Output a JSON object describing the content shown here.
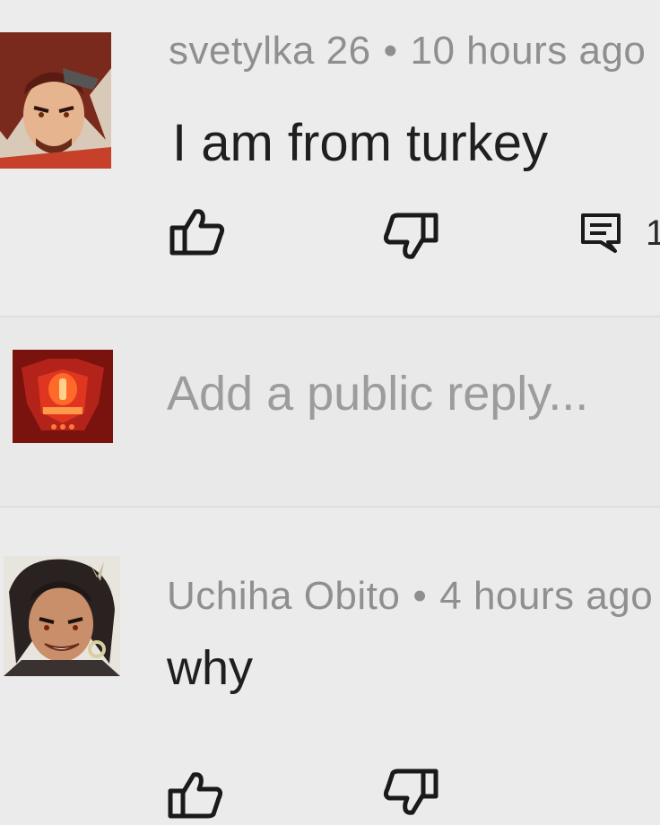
{
  "comments": [
    {
      "author": "svetylka 26",
      "separator": "•",
      "time": "10 hours ago",
      "text": "I am from turkey",
      "reply_count": "1",
      "avatar": "anime-warrior-avatar"
    },
    {
      "author": "Uchiha Obito",
      "separator": "•",
      "time": "4 hours ago",
      "text": "why",
      "avatar": "anime-woman-avatar"
    }
  ],
  "reply_box": {
    "placeholder": "Add a public reply...",
    "avatar": "red-robot-avatar"
  },
  "icons": {
    "like": "thumbs-up-icon",
    "dislike": "thumbs-down-icon",
    "reply": "comment-icon"
  },
  "colors": {
    "background": "#ebebeb",
    "meta_text": "#8f8f8f",
    "body_text": "#1f1f1f",
    "placeholder": "#9c9c9c"
  }
}
